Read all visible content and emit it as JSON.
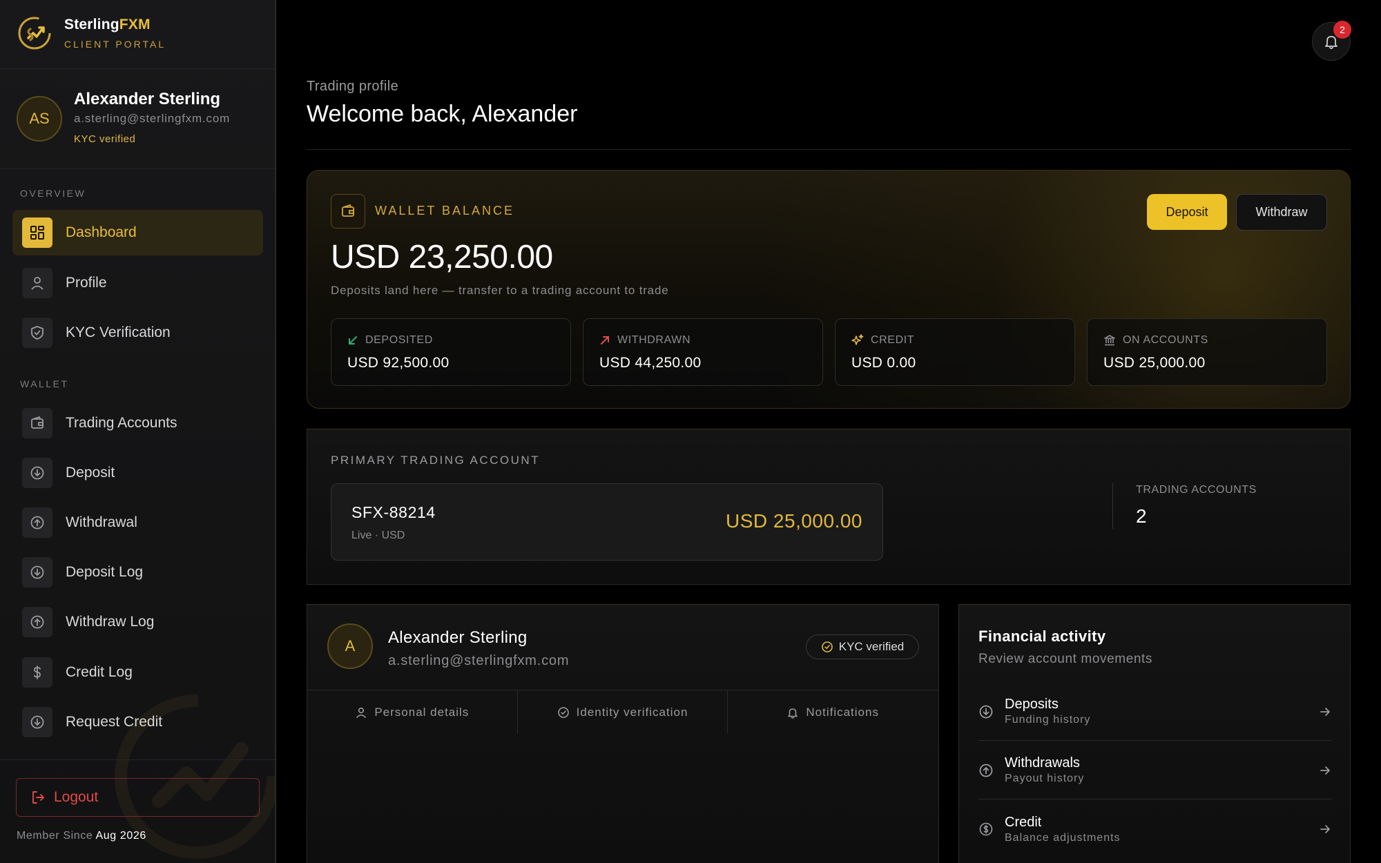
{
  "brand": {
    "name_main": "Sterling",
    "name_accent": "FXM",
    "subtitle": "CLIENT PORTAL"
  },
  "user": {
    "initials": "AS",
    "name": "Alexander Sterling",
    "email": "a.sterling@sterlingfxm.com",
    "kyc_status": "KYC verified"
  },
  "sidebar": {
    "section_overview": "OVERVIEW",
    "section_wallet": "WALLET",
    "overview_items": [
      {
        "label": "Dashboard",
        "icon": "grid-icon",
        "active": true
      },
      {
        "label": "Profile",
        "icon": "user-icon"
      },
      {
        "label": "KYC Verification",
        "icon": "shield-check-icon"
      }
    ],
    "wallet_items": [
      {
        "label": "Trading Accounts",
        "icon": "wallet-icon"
      },
      {
        "label": "Deposit",
        "icon": "arrow-down-circle-icon"
      },
      {
        "label": "Withdrawal",
        "icon": "arrow-up-circle-icon"
      },
      {
        "label": "Deposit Log",
        "icon": "arrow-down-circle-icon"
      },
      {
        "label": "Withdraw Log",
        "icon": "arrow-up-circle-icon"
      },
      {
        "label": "Credit Log",
        "icon": "dollar-icon"
      },
      {
        "label": "Request Credit",
        "icon": "arrow-down-circle-icon"
      }
    ],
    "logout_label": "Logout",
    "member_since_label": "Member Since",
    "member_since_value": "Aug 2026"
  },
  "header": {
    "notification_count": "2",
    "subtitle": "Trading profile",
    "title": "Welcome back, Alexander"
  },
  "wallet": {
    "label": "WALLET BALANCE",
    "amount": "USD 23,250.00",
    "note": "Deposits land here — transfer to a trading account to trade",
    "deposit_label": "Deposit",
    "withdraw_label": "Withdraw",
    "stats": [
      {
        "label": "DEPOSITED",
        "value": "USD 92,500.00",
        "icon": "arrow-down-left-icon",
        "color": "#2fb37a"
      },
      {
        "label": "WITHDRAWN",
        "value": "USD 44,250.00",
        "icon": "arrow-up-right-icon",
        "color": "#e0504a"
      },
      {
        "label": "CREDIT",
        "value": "USD 0.00",
        "icon": "sparkles-icon",
        "color": "#e0b842"
      },
      {
        "label": "ON ACCOUNTS",
        "value": "USD 25,000.00",
        "icon": "bank-icon",
        "color": "#8d8d91"
      }
    ]
  },
  "primary_account": {
    "label": "PRIMARY TRADING ACCOUNT",
    "account_id": "SFX-88214",
    "meta": "Live · USD",
    "balance": "USD 25,000.00",
    "trading_accounts_label": "TRADING ACCOUNTS",
    "trading_accounts_count": "2"
  },
  "profile_card": {
    "initial": "A",
    "name": "Alexander Sterling",
    "email": "a.sterling@sterlingfxm.com",
    "kyc_badge": "KYC verified",
    "tabs": [
      "Personal details",
      "Identity verification",
      "Notifications"
    ]
  },
  "activity": {
    "title": "Financial activity",
    "subtitle": "Review account movements",
    "rows": [
      {
        "title": "Deposits",
        "subtitle": "Funding history",
        "icon": "arrow-down-circle-icon"
      },
      {
        "title": "Withdrawals",
        "subtitle": "Payout history",
        "icon": "arrow-up-circle-icon"
      },
      {
        "title": "Credit",
        "subtitle": "Balance adjustments",
        "icon": "dollar-circle-icon"
      }
    ]
  },
  "colors": {
    "accent": "#e3b93a",
    "danger": "#e34848",
    "background": "#000000"
  }
}
